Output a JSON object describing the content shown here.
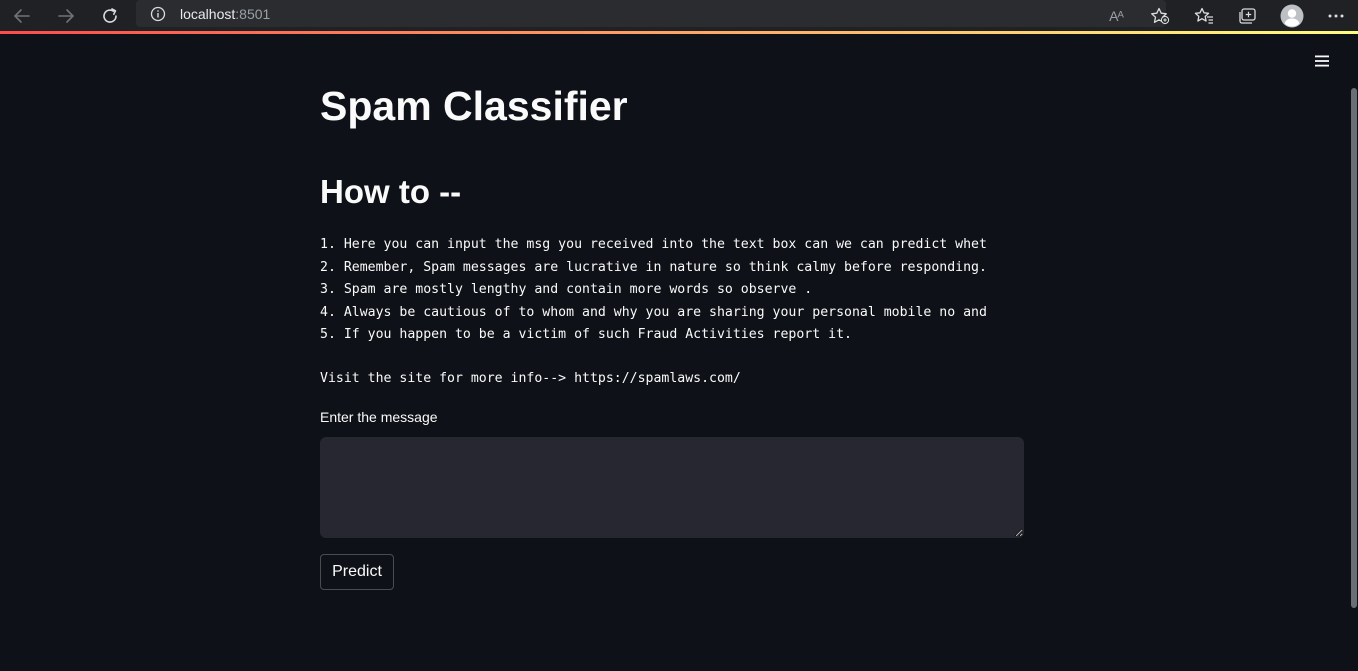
{
  "browser": {
    "url_host": "localhost",
    "url_port": ":8501",
    "read_aloud_glyph": "Aᴬ"
  },
  "app": {
    "title": "Spam Classifier",
    "section_heading": "How to --",
    "instructions": [
      "1. Here you can input the msg you received into the text box can we can predict whet",
      "2. Remember, Spam messages are lucrative in nature so think calmy before responding.",
      "3. Spam are mostly lengthy and contain more words so observe .",
      "4. Always be cautious of to whom and why you are sharing your personal mobile no and",
      "5. If you happen to be a victim of such Fraud Activities report it."
    ],
    "visit_text": "Visit the site for more info--> https://spamlaws.com/",
    "input_label": "Enter the message",
    "input_value": "",
    "predict_label": "Predict"
  },
  "colors": {
    "background": "#0e1117",
    "text": "#fafafa",
    "input_background": "#262730",
    "accent_gradient_start": "#ff4b4b",
    "accent_gradient_end": "#fffd80"
  }
}
